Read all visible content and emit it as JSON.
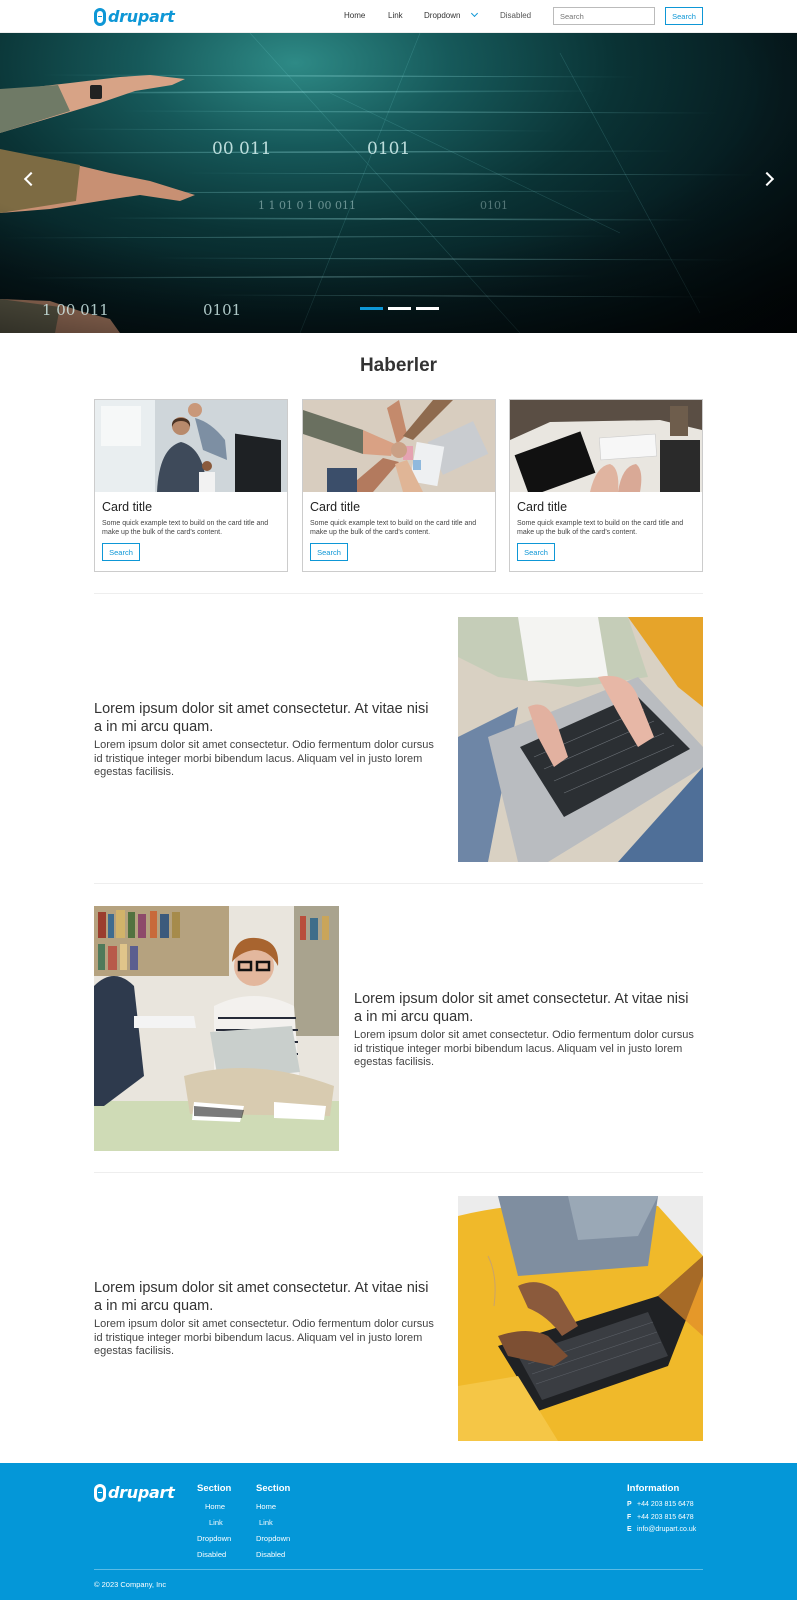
{
  "brand": {
    "name": "drupart",
    "accent": "#0e97d6",
    "footer_bg": "#0497d8"
  },
  "nav": {
    "links": [
      "Home",
      "Link",
      "Dropdown",
      "Disabled"
    ],
    "search_placeholder": "Search",
    "search_button": "Search"
  },
  "hero": {
    "digits": [
      "00 011",
      "0101",
      "1 1  01 0 1  00  011",
      "0101",
      "1  00  011",
      "0101"
    ],
    "slide_count": 3,
    "active_slide": 1
  },
  "news": {
    "title": "Haberler",
    "cards": [
      {
        "title": "Card title",
        "text": "Some quick example text to build on the card title and make up the bulk of the card's content.",
        "button": "Search"
      },
      {
        "title": "Card title",
        "text": "Some quick example text to build on the card title and make up the bulk of the card's content.",
        "button": "Search"
      },
      {
        "title": "Card title",
        "text": "Some quick example text to build on the card title and make up the bulk of the card's content.",
        "button": "Search"
      }
    ]
  },
  "features": [
    {
      "heading": "Lorem ipsum dolor sit amet consectetur. At vitae nisi a in mi arcu quam.",
      "body": "Lorem ipsum dolor sit amet consectetur. Odio fermentum dolor cursus id tristique integer morbi bibendum lacus. Aliquam vel in justo lorem egestas facilisis."
    },
    {
      "heading": "Lorem ipsum dolor sit amet consectetur. At vitae nisi a in mi arcu quam.",
      "body": "Lorem ipsum dolor sit amet consectetur. Odio fermentum dolor cursus id tristique integer morbi bibendum lacus. Aliquam vel in justo lorem egestas facilisis."
    },
    {
      "heading": "Lorem ipsum dolor sit amet consectetur. At vitae nisi a in mi arcu quam.",
      "body": "Lorem ipsum dolor sit amet consectetur. Odio fermentum dolor cursus id tristique integer morbi bibendum lacus. Aliquam vel in justo lorem egestas facilisis."
    }
  ],
  "footer": {
    "sections": [
      {
        "title": "Section",
        "links": [
          "Home",
          "Link",
          "Dropdown",
          "Disabled"
        ]
      },
      {
        "title": "Section",
        "links": [
          "Home",
          "Link",
          "Dropdown",
          "Disabled"
        ]
      }
    ],
    "info": {
      "title": "Information",
      "rows": [
        {
          "label": "P",
          "value": "+44 203 815 6478"
        },
        {
          "label": "F",
          "value": "+44 203 815 6478"
        },
        {
          "label": "E",
          "value": "info@drupart.co.uk"
        }
      ]
    },
    "copyright": "© 2023 Company, Inc"
  }
}
